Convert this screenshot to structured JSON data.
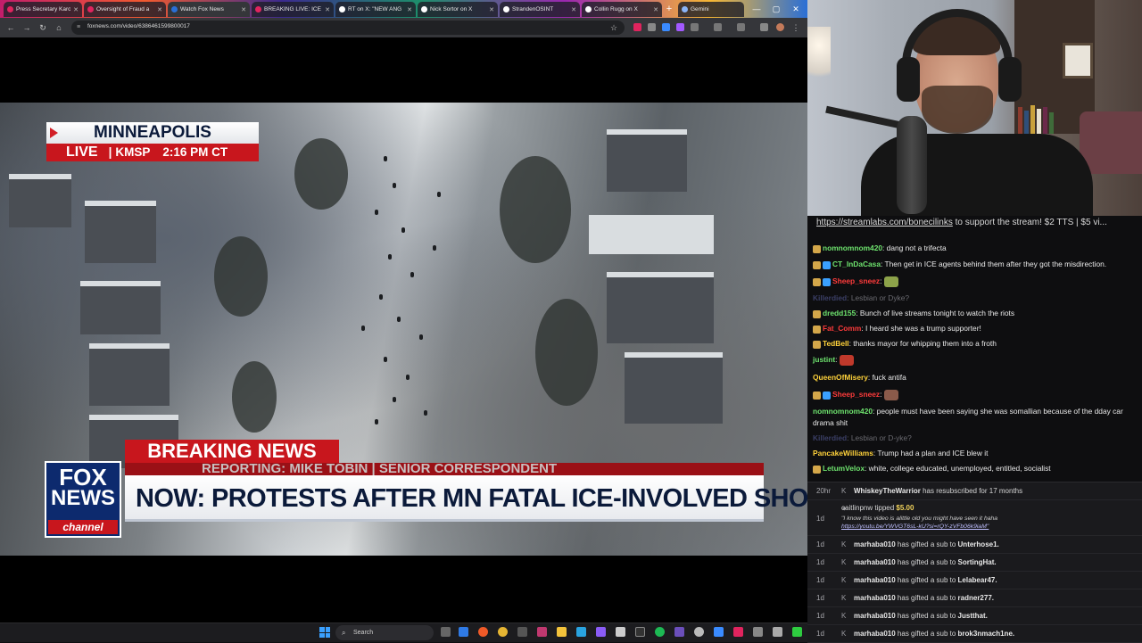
{
  "browser": {
    "tabs": [
      {
        "label": "Press Secretary Karo",
        "color": "#e0245e"
      },
      {
        "label": "Oversight of Fraud a",
        "color": "#e0245e"
      },
      {
        "label": "Watch Fox News",
        "color": "#2a6fd6"
      },
      {
        "label": "BREAKING LIVE: ICE",
        "color": "#e0245e"
      },
      {
        "label": "RT on X: \"NEW ANG",
        "color": "#ffffff"
      },
      {
        "label": "Nick Sortor on X",
        "color": "#ffffff"
      },
      {
        "label": "StrandenOSINT",
        "color": "#ffffff"
      },
      {
        "label": "Collin Rugg on X",
        "color": "#ffffff"
      },
      {
        "label": "Gemini",
        "color": "#8ab4f8"
      }
    ],
    "url": "foxnews.com/video/6386461599800017",
    "window_controls": {
      "minimize": "—",
      "maximize": "▢",
      "close": "✕"
    }
  },
  "broadcast": {
    "city": "MINNEAPOLIS",
    "live_label": "LIVE",
    "station": "KMSP",
    "time": "2:16 PM CT",
    "breaking": "BREAKING NEWS",
    "reporting": "REPORTING: MIKE TOBIN | SENIOR CORRESPONDENT",
    "headline": "NOW: PROTESTS AFTER MN FATAL ICE-INVOLVED SHOOTING",
    "logo": {
      "word1": "FOX",
      "word2": "NEWS",
      "word3": "channel"
    }
  },
  "taskbar": {
    "search_placeholder": "Search"
  },
  "chat": {
    "banner_link": "https://streamlabs.com/bonecilinks",
    "banner_text": " to support the stream! $2 TTS | $5 vi...",
    "messages": [
      {
        "user": "nomnomnom420",
        "color": "#6ee36e",
        "text": "dang not a trifecta",
        "deleted": false
      },
      {
        "user": "CT_InDaCasa",
        "color": "#6ee36e",
        "text": "Then get in ICE agents behind them after they got the misdirection.",
        "deleted": false
      },
      {
        "user": "Sheep_sneez",
        "color": "#ff3b3b",
        "text": "",
        "deleted": false
      },
      {
        "user": "Killerdied",
        "color": "#3b3f66",
        "text": "Lesbian or Dyke?",
        "deleted": true
      },
      {
        "user": "dredd155",
        "color": "#6ee36e",
        "text": "Bunch of live streams tonight to watch the riots",
        "deleted": false
      },
      {
        "user": "Fat_Comm",
        "color": "#ff3b3b",
        "text": "I heard she was a trump supporter!",
        "deleted": false
      },
      {
        "user": "TedBell",
        "color": "#ffd23b",
        "text": "thanks mayor for whipping them into a froth",
        "deleted": false
      },
      {
        "user": "justint",
        "color": "#6ee36e",
        "text": "",
        "deleted": false
      },
      {
        "user": "QueenOfMisery",
        "color": "#ffd23b",
        "text": "fuck antifa",
        "deleted": false
      },
      {
        "user": "Sheep_sneez",
        "color": "#ff3b3b",
        "text": "",
        "deleted": false
      },
      {
        "user": "nomnomnom420",
        "color": "#6ee36e",
        "text": "people must have been saying she was somallian because of the dday car drama shit",
        "deleted": false
      },
      {
        "user": "Killerdied",
        "color": "#3b3f66",
        "text": "Lesbian or D-yke?",
        "deleted": true
      },
      {
        "user": "PancakeWilliams",
        "color": "#ffd23b",
        "text": "Trump had a plan and ICE blew it",
        "deleted": false
      },
      {
        "user": "LetumVelox",
        "color": "#6ee36e",
        "text": "white, college educated, unemployed, entitled, socialist",
        "deleted": false
      }
    ]
  },
  "events": {
    "resub": {
      "time": "20hr",
      "user": "WhiskeyTheWarrior",
      "text": " has resubscribed for 17 months"
    },
    "tip": {
      "time": "1d",
      "user": "caitlinpnw",
      "verb": " tipped ",
      "amount": "$5.00",
      "message": "\"I know this video is alittle old you might have seen it haha",
      "link": "https://youtu.be/YWVGT6sL-kU?si=rQY-zVFb06k9iaM\""
    },
    "gifts": [
      {
        "time": "1d",
        "gifter": "marhaba010",
        "verb": " has gifted a sub to ",
        "recipient": "Unterhose1."
      },
      {
        "time": "1d",
        "gifter": "marhaba010",
        "verb": " has gifted a sub to ",
        "recipient": "SortingHat."
      },
      {
        "time": "1d",
        "gifter": "marhaba010",
        "verb": " has gifted a sub to ",
        "recipient": "Lelabear47."
      },
      {
        "time": "1d",
        "gifter": "marhaba010",
        "verb": " has gifted a sub to ",
        "recipient": "radner277."
      },
      {
        "time": "1d",
        "gifter": "marhaba010",
        "verb": " has gifted a sub to ",
        "recipient": "Justthat."
      },
      {
        "time": "1d",
        "gifter": "marhaba010",
        "verb": " has gifted a sub to ",
        "recipient": "brok3nmach1ne."
      }
    ]
  }
}
